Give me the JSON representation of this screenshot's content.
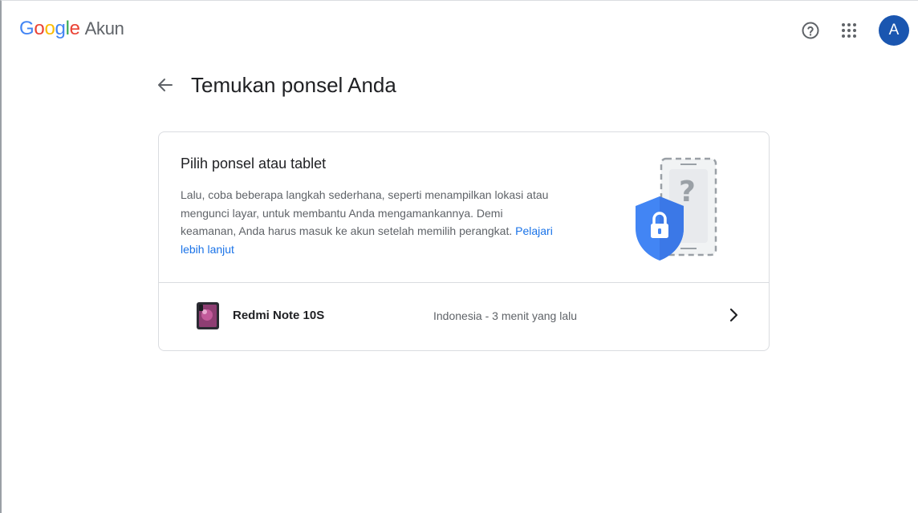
{
  "header": {
    "logo_letters": [
      "G",
      "o",
      "o",
      "g",
      "l",
      "e"
    ],
    "product": "Akun",
    "help_icon": "help-circle-icon",
    "apps_icon": "apps-grid-icon",
    "avatar_initial": "A",
    "avatar_color": "#1a56b0"
  },
  "page": {
    "back_icon": "arrow-back-icon",
    "title": "Temukan ponsel Anda"
  },
  "card": {
    "heading": "Pilih ponsel atau tablet",
    "description": "Lalu, coba beberapa langkah sederhana, seperti menampilkan lokasi atau mengunci layar, untuk membantu Anda mengamankannya. Demi keamanan, Anda harus masuk ke akun setelah memilih perangkat.",
    "learn_more": "Pelajari lebih lanjut",
    "illustration_icon": "phone-shield-lock-icon"
  },
  "devices": [
    {
      "name": "Redmi Note 10S",
      "meta": "Indonesia - 3 menit yang lalu",
      "chevron_icon": "chevron-right-icon"
    }
  ],
  "colors": {
    "link": "#1a73e8",
    "shield": "#4285f4",
    "google_blue": "#4285f4",
    "google_red": "#ea4335",
    "google_yellow": "#fbbc05",
    "google_green": "#34a853"
  }
}
